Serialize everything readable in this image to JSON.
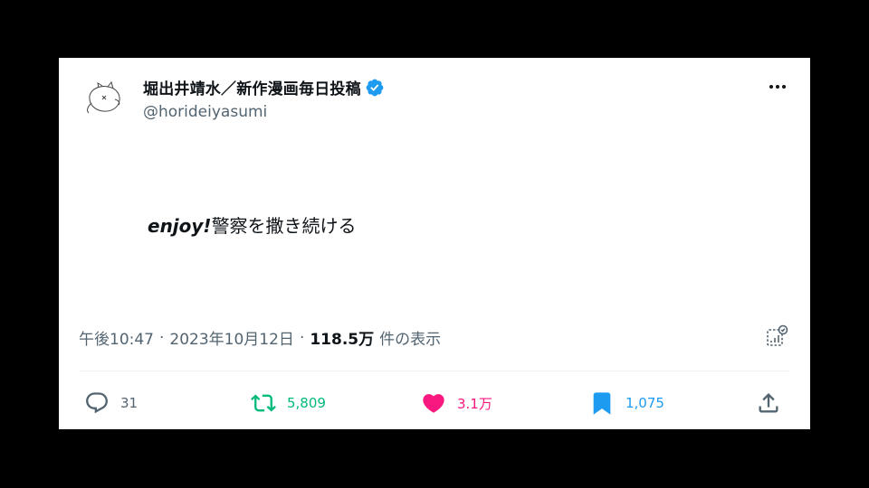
{
  "user": {
    "display_name": "堀出井靖水／新作漫画毎日投稿",
    "handle": "@horideiyasumi",
    "verified": true
  },
  "tweet": {
    "text_en": "enjoy!",
    "text_ja": "警察を撒き続ける"
  },
  "meta": {
    "time": "午後10:47",
    "sep1": "·",
    "date": "2023年10月12日",
    "sep2": "·",
    "views": "118.5万",
    "views_label": "件の表示"
  },
  "actions": {
    "replies": "31",
    "retweets": "5,809",
    "likes": "3.1万",
    "bookmarks": "1,075"
  },
  "colors": {
    "verified": "#1d9bf0",
    "retweet": "#00ba7c",
    "like": "#f91880",
    "bookmark": "#1d9bf0",
    "secondary_text": "#536471"
  },
  "icons": {
    "more": "more-horizontal-icon",
    "analytics": "analytics-icon",
    "reply": "reply-icon",
    "retweet": "retweet-icon",
    "like": "heart-icon",
    "bookmark": "bookmark-icon",
    "share": "share-icon"
  }
}
